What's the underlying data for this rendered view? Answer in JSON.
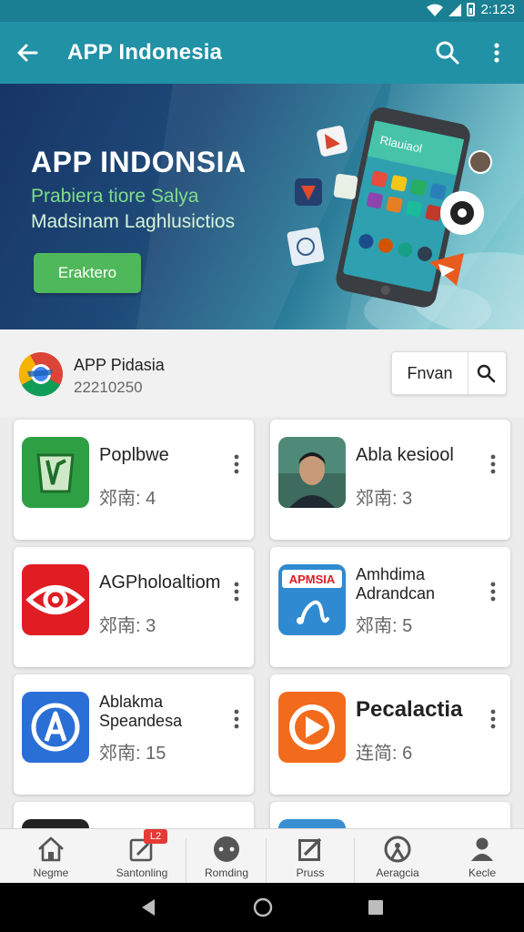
{
  "status_bar": {
    "time": "2:123"
  },
  "app_bar": {
    "title": "APP Indonesia"
  },
  "banner": {
    "headline": "APP INDONSIA",
    "subtitle_line1": "Prabiera tiore Salya",
    "subtitle_line2": "Madsinam Laghlusictios",
    "cta_label": "Eraktero",
    "phone_screen_text": "Rlauiaol"
  },
  "account": {
    "name": "APP Pidasia",
    "number": "22210250",
    "action_label": "Fnvan"
  },
  "apps": [
    {
      "title": "Poplbwe",
      "meta": "郊南: 4",
      "icon": "green-shield-icon"
    },
    {
      "title": "Abla kesiool",
      "meta": "郊南: 3",
      "icon": "person-photo-icon"
    },
    {
      "title": "AGPholoaltiom",
      "meta": "郊南: 3",
      "icon": "red-eye-icon"
    },
    {
      "title": "Amhdima Adrandcan",
      "meta": "郊南: 5",
      "icon": "music-note-icon",
      "icon_text": "APMSIA"
    },
    {
      "title": "Ablakma Speandesa",
      "meta": "郊南: 15",
      "icon": "blue-a-icon"
    },
    {
      "title": "Pecalactia",
      "meta": "连简: 6",
      "icon": "orange-play-icon"
    }
  ],
  "bottom_nav": [
    {
      "label": "Negme",
      "icon": "home-icon"
    },
    {
      "label": "Santonling",
      "icon": "edit-icon"
    },
    {
      "label": "Romding",
      "icon": "chat-icon"
    },
    {
      "label": "Pruss",
      "icon": "compose-icon"
    },
    {
      "label": "Aeragcia",
      "icon": "explore-icon"
    },
    {
      "label": "Kecle",
      "icon": "person-icon"
    }
  ],
  "badge": "L2",
  "colors": {
    "app_bar": "#2191a6",
    "status_bar": "#1a7f93",
    "cta": "#4fb85a",
    "badge": "#e53935"
  }
}
